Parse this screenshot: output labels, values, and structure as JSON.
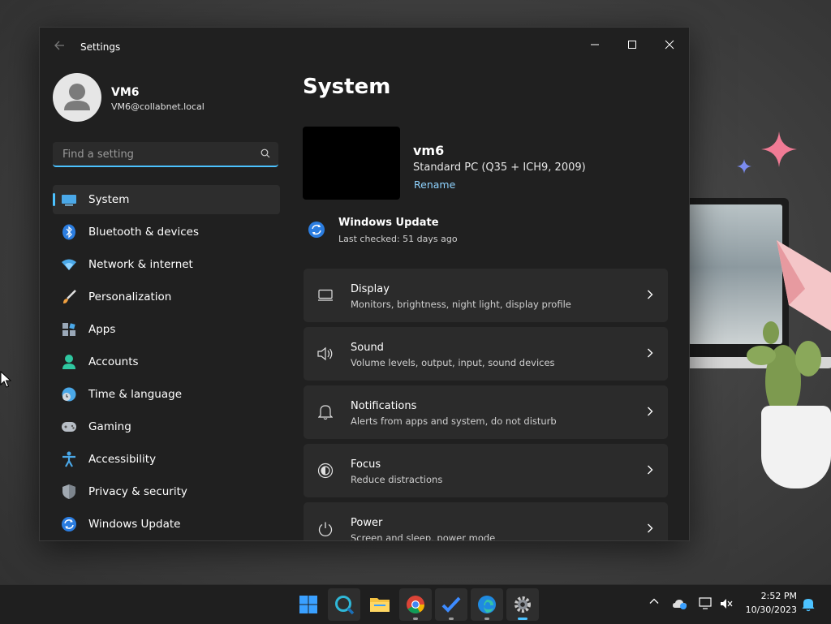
{
  "window": {
    "title": "Settings",
    "back_icon": "back-arrow-icon"
  },
  "profile": {
    "name": "VM6",
    "email": "VM6@collabnet.local"
  },
  "search": {
    "placeholder": "Find a setting",
    "value": ""
  },
  "sidebar": {
    "items": [
      {
        "label": "System",
        "icon": "monitor-icon",
        "selected": true
      },
      {
        "label": "Bluetooth & devices",
        "icon": "bluetooth-icon"
      },
      {
        "label": "Network & internet",
        "icon": "wifi-icon"
      },
      {
        "label": "Personalization",
        "icon": "paintbrush-icon"
      },
      {
        "label": "Apps",
        "icon": "apps-icon"
      },
      {
        "label": "Accounts",
        "icon": "person-icon"
      },
      {
        "label": "Time & language",
        "icon": "globe-clock-icon"
      },
      {
        "label": "Gaming",
        "icon": "gamepad-icon"
      },
      {
        "label": "Accessibility",
        "icon": "accessibility-icon"
      },
      {
        "label": "Privacy & security",
        "icon": "shield-icon"
      },
      {
        "label": "Windows Update",
        "icon": "update-icon"
      }
    ]
  },
  "main": {
    "title": "System",
    "device": {
      "name": "vm6",
      "model": "Standard PC (Q35 + ICH9, 2009)",
      "rename": "Rename"
    },
    "windows_update": {
      "title": "Windows Update",
      "subtitle": "Last checked: 51 days ago"
    },
    "cards": [
      {
        "title": "Display",
        "desc": "Monitors, brightness, night light, display profile",
        "icon": "display-icon"
      },
      {
        "title": "Sound",
        "desc": "Volume levels, output, input, sound devices",
        "icon": "speaker-icon"
      },
      {
        "title": "Notifications",
        "desc": "Alerts from apps and system, do not disturb",
        "icon": "bell-icon"
      },
      {
        "title": "Focus",
        "desc": "Reduce distractions",
        "icon": "focus-icon"
      },
      {
        "title": "Power",
        "desc": "Screen and sleep, power mode",
        "icon": "power-icon"
      }
    ]
  },
  "taskbar": {
    "apps": [
      "start-icon",
      "search-app-icon",
      "file-explorer-icon",
      "chrome-icon",
      "todo-icon",
      "edge-icon",
      "settings-icon"
    ],
    "time": "2:52 PM",
    "date": "10/30/2023"
  },
  "colors": {
    "accent": "#4cc2ff",
    "window_bg": "#202020",
    "card_bg": "#2b2b2b"
  }
}
